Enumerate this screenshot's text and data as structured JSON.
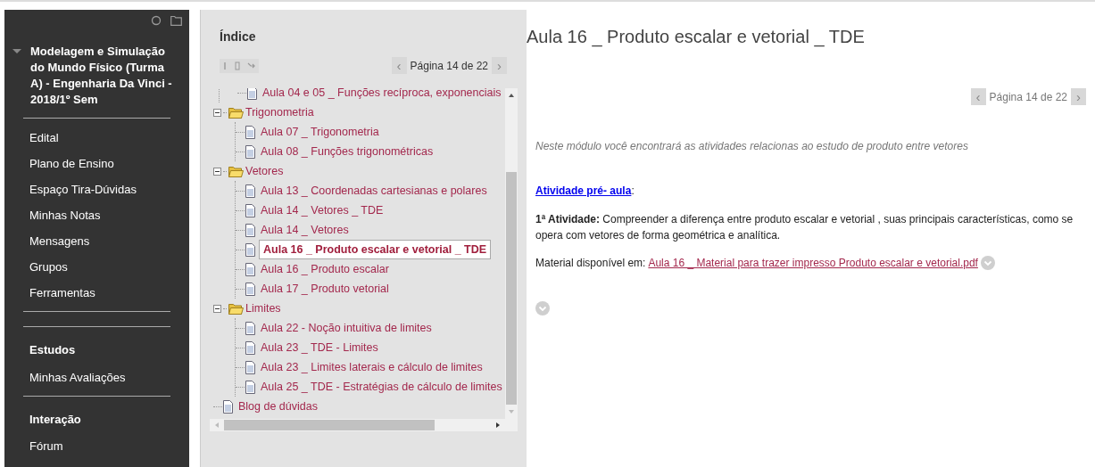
{
  "sidebar": {
    "course": {
      "title": "Modelagem e Simulação do Mundo Físico (Turma A) - Engenharia Da Vinci - 2018/1º Sem",
      "expanded": true
    },
    "sections": [
      {
        "items": [
          "Edital",
          "Plano de Ensino",
          "Espaço Tira-Dúvidas",
          "Minhas Notas",
          "Mensagens",
          "Grupos",
          "Ferramentas"
        ]
      },
      {
        "heading": "Estudos",
        "items": [
          "Minhas Avaliações"
        ]
      },
      {
        "heading": "Interação",
        "items": [
          "Fórum"
        ]
      }
    ]
  },
  "index": {
    "title": "Índice",
    "pagination": {
      "prev": "‹",
      "label": "Página 14 de 22",
      "next": "›"
    },
    "tree": [
      {
        "kind": "continued",
        "children": [
          {
            "kind": "page",
            "label": "Aula 04 e 05 _ Funções recíproca, exponenciais",
            "selected": false
          }
        ]
      },
      {
        "kind": "folder",
        "label": "Trigonometria",
        "expanded": true,
        "children": [
          {
            "kind": "page",
            "label": "Aula 07 _ Trigonometria",
            "selected": false
          },
          {
            "kind": "page",
            "label": "Aula 08 _ Funções trigonométricas",
            "selected": false
          }
        ]
      },
      {
        "kind": "folder",
        "label": "Vetores",
        "expanded": true,
        "children": [
          {
            "kind": "page",
            "label": "Aula 13 _ Coordenadas cartesianas e polares",
            "selected": false
          },
          {
            "kind": "page",
            "label": "Aula 14 _ Vetores _ TDE",
            "selected": false
          },
          {
            "kind": "page",
            "label": "Aula 14 _ Vetores",
            "selected": false
          },
          {
            "kind": "page",
            "label": "Aula 16 _ Produto escalar e vetorial _ TDE",
            "selected": true
          },
          {
            "kind": "page",
            "label": "Aula 16 _ Produto escalar",
            "selected": false
          },
          {
            "kind": "page",
            "label": "Aula 17 _ Produto vetorial",
            "selected": false
          }
        ]
      },
      {
        "kind": "folder",
        "label": "Limites",
        "expanded": true,
        "children": [
          {
            "kind": "page",
            "label": "Aula 22 - Noção intuitiva de limites",
            "selected": false
          },
          {
            "kind": "page",
            "label": "Aula 23 _ TDE - Limites",
            "selected": false
          },
          {
            "kind": "page",
            "label": "Aula 23 _ Limites laterais e cálculo de limites",
            "selected": false
          },
          {
            "kind": "page",
            "label": "Aula 25 _ TDE - Estratégias de cálculo de limites",
            "selected": false
          }
        ]
      },
      {
        "kind": "page",
        "label": "Blog de dúvidas",
        "selected": false
      }
    ]
  },
  "content": {
    "title": "Aula 16 _ Produto escalar e vetorial _ TDE",
    "pagination": {
      "prev": "‹",
      "label": "Página 14 de 22",
      "next": "›"
    },
    "description": "Neste módulo você encontrará as atividades relacionas ao estudo de produto entre vetores",
    "activity_link": "Atividade pré- aula",
    "activity_colon": ":",
    "paragraph": "**1ª Atividade:** Compreender a diferença entre produto escalar e vetorial , suas principais características, como se opera com vetores de forma geométrica e analítica.",
    "material_label": "Material disponível em:",
    "material_link": "Aula 16 _ Material para trazer impresso Produto escalar e vetorial.pdf"
  }
}
